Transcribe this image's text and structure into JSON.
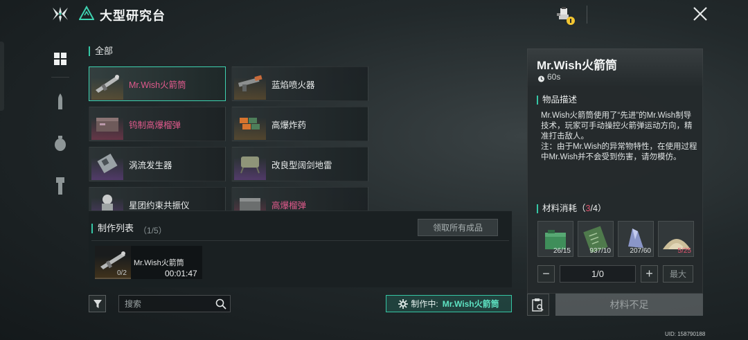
{
  "header": {
    "title": "大型研究台"
  },
  "grid": {
    "section_label": "全部",
    "items": [
      {
        "name": "Mr.Wish火箭筒",
        "color": "pink",
        "bg": "orange",
        "icon": "rocket-launcher-icon",
        "selected": true
      },
      {
        "name": "蓝焰喷火器",
        "color": "white",
        "bg": "orange",
        "icon": "flamethrower-icon",
        "selected": false
      },
      {
        "name": "钨制高爆榴弹",
        "color": "pink",
        "bg": "pink",
        "icon": "grenade-box-icon",
        "selected": false
      },
      {
        "name": "高爆炸药",
        "color": "white",
        "bg": "orange",
        "icon": "explosive-icon",
        "selected": false
      },
      {
        "name": "涡流发生器",
        "color": "white",
        "bg": "purple",
        "icon": "vortex-generator-icon",
        "selected": false
      },
      {
        "name": "改良型阔剑地雷",
        "color": "white",
        "bg": "purple",
        "icon": "claymore-mine-icon",
        "selected": false
      },
      {
        "name": "星团约束共振仪",
        "color": "white",
        "bg": "purple",
        "icon": "resonator-icon",
        "selected": false
      },
      {
        "name": "高爆榴弹",
        "color": "pink",
        "bg": "pink",
        "icon": "grenade-case-icon",
        "selected": false
      }
    ]
  },
  "craft_list": {
    "title": "制作列表",
    "count": "（1/5）",
    "collect_label": "领取所有成品",
    "queue": [
      {
        "name": "Mr.Wish火箭筒",
        "progress": "0/2",
        "progress_fraction": 0.0,
        "time": "00:01:47"
      }
    ]
  },
  "bottom": {
    "search_placeholder": "搜索",
    "status_label": "制作中:",
    "status_value": "Mr.Wish火箭筒"
  },
  "detail": {
    "title": "Mr.Wish火箭筒",
    "time": "60s",
    "desc_label": "物品描述",
    "description": "Mr.Wish火箭筒使用了“先进”的Mr.Wish制导技术，玩家可手动操控火箭弹运动方向，精准打击敌人。\n注：由于Mr.Wish的异常物特性，在使用过程中Mr.Wish并不会受到伤害，请勿模仿。",
    "materials_label": "材料消耗",
    "materials_count_open": "（",
    "materials_have": "3",
    "materials_count_close": "/4）",
    "materials": [
      {
        "qty": "26/15",
        "ok": true,
        "icon": "green-case-icon"
      },
      {
        "qty": "937/10",
        "ok": true,
        "icon": "circuit-board-icon"
      },
      {
        "qty": "207/60",
        "ok": true,
        "icon": "crystal-icon"
      },
      {
        "qty": "5/25",
        "ok": false,
        "icon": "sand-pile-icon"
      }
    ],
    "minus": "−",
    "plus": "+",
    "quantity": "1/0",
    "max_label": "最大",
    "craft_button": "材料不足"
  },
  "uid": "UID: 158790188",
  "colors": {
    "accent": "#35c7a6",
    "rare": "#e05a8c",
    "insufficient": "#e0536e"
  }
}
